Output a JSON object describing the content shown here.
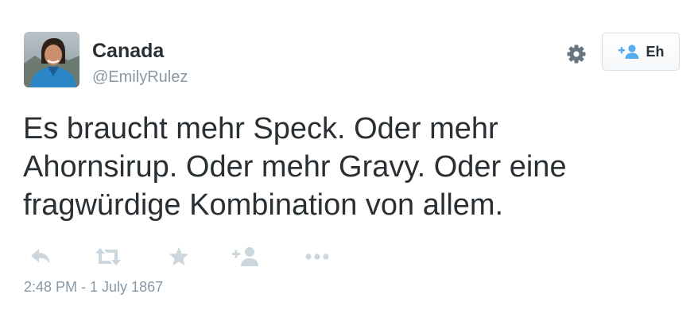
{
  "user": {
    "display_name": "Canada",
    "handle": "@EmilyRulez"
  },
  "header": {
    "follow_button_label": "Eh",
    "settings_icon": "gear-icon",
    "follow_icon": "add-user-icon"
  },
  "tweet": {
    "text_lines": [
      "Es braucht mehr Speck. Oder mehr",
      "Ahornsirup. Oder mehr Gravy. Oder eine",
      "fragwürdige Kombination von allem."
    ],
    "timestamp": "2:48 PM - 1 July 1867"
  },
  "actions": [
    {
      "name": "reply",
      "icon": "reply-icon"
    },
    {
      "name": "retweet",
      "icon": "retweet-icon"
    },
    {
      "name": "favorite",
      "icon": "star-icon"
    },
    {
      "name": "follow",
      "icon": "add-user-icon"
    },
    {
      "name": "more",
      "icon": "more-dots-icon"
    }
  ],
  "colors": {
    "text": "#292f33",
    "muted": "#8899a6",
    "action_icon": "#ccd6dd",
    "follow_icon_blue": "#55acee"
  }
}
